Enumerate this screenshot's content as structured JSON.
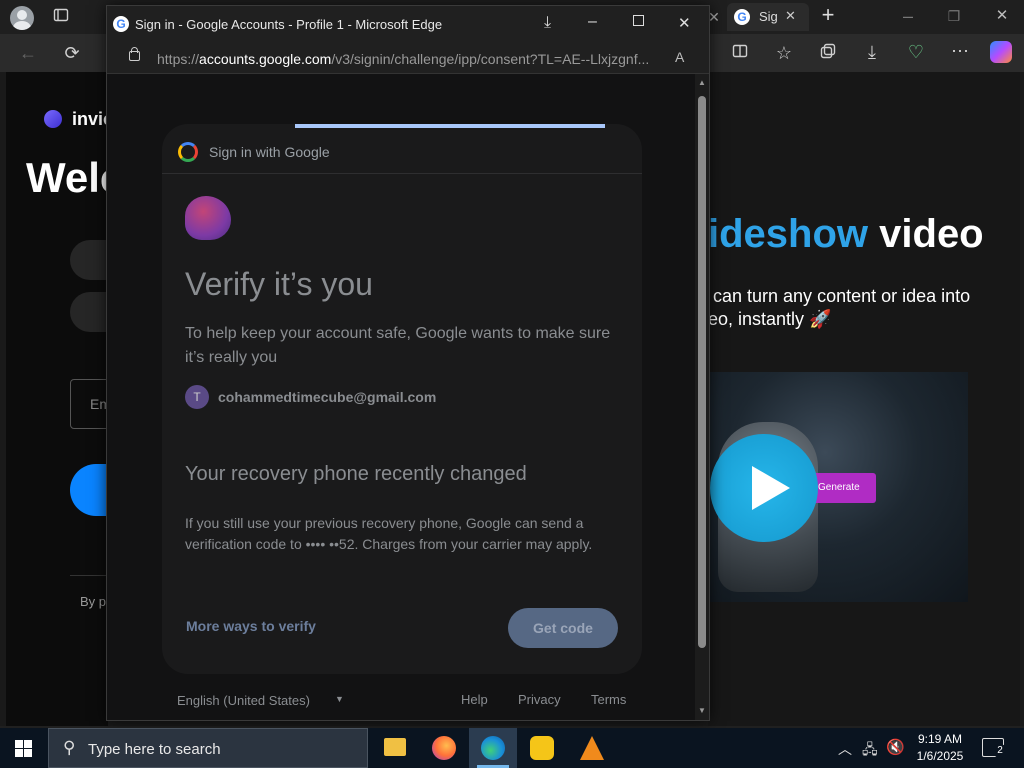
{
  "background_browser": {
    "tab_label": "Sig",
    "page": {
      "brand": "invic",
      "heading": "Welc",
      "email_placeholder": "Em",
      "footer_prefix": "By p",
      "hero_title_gradient": "ideshow",
      "hero_title_rest": " video",
      "hero_subtitle_line1": "can turn any content or idea into",
      "hero_subtitle_line2": "eo, instantly 🚀",
      "preview_button": "Generate"
    }
  },
  "popup": {
    "window_title": "Sign in - Google Accounts - Profile 1 - Microsoft Edge",
    "url_prefix": "https://",
    "url_domain": "accounts.google.com",
    "url_path": "/v3/signin/challenge/ipp/consent?TL=AE--Llxjzgnf...",
    "header": "Sign in with Google",
    "title": "Verify it’s you",
    "description": "To help keep your account safe, Google wants to make sure it’s really you",
    "account_initial": "T",
    "account_email": "cohammedtimecube@gmail.com",
    "section_title": "Your recovery phone recently changed",
    "section_text": "If you still use your previous recovery phone, Google can send a verification code to •••• ••52. Charges from your carrier may apply.",
    "more_ways": "More ways to verify",
    "get_code": "Get code",
    "language": "English (United States)",
    "footer_links": [
      "Help",
      "Privacy",
      "Terms"
    ]
  },
  "taskbar": {
    "search_placeholder": "Type here to search",
    "time": "9:19 AM",
    "date": "1/6/2025",
    "notification_count": "2"
  }
}
